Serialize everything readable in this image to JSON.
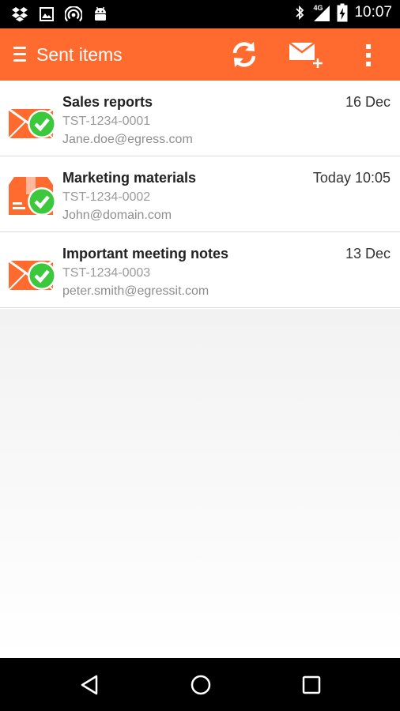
{
  "status_bar": {
    "time": "10:07",
    "network_label": "4G",
    "left_icons": [
      "dropbox-icon",
      "image-icon",
      "wireless-icon",
      "android-icon"
    ],
    "right_icons": [
      "bluetooth-icon",
      "signal-icon",
      "battery-charging-icon"
    ]
  },
  "action_bar": {
    "title": "Sent items",
    "background": "#ff6a2f",
    "actions": [
      "refresh-icon",
      "compose-mail-icon",
      "overflow-menu-icon"
    ]
  },
  "messages": [
    {
      "title": "Sales reports",
      "reference": "TST-1234-0001",
      "email": "Jane.doe@egress.com",
      "date": "16 Dec",
      "icon": "envelope-sent-icon"
    },
    {
      "title": "Marketing materials",
      "reference": "TST-1234-0002",
      "email": "John@domain.com",
      "date": "Today 10:05",
      "icon": "package-sent-icon"
    },
    {
      "title": "Important meeting notes",
      "reference": "TST-1234-0003",
      "email": "peter.smith@egressit.com",
      "date": "13 Dec",
      "icon": "envelope-sent-icon"
    }
  ],
  "colors": {
    "accent": "#ff6a2f",
    "status_ok": "#3cc83c"
  },
  "nav_bar": {
    "buttons": [
      "back-icon",
      "home-icon",
      "recents-icon"
    ]
  }
}
